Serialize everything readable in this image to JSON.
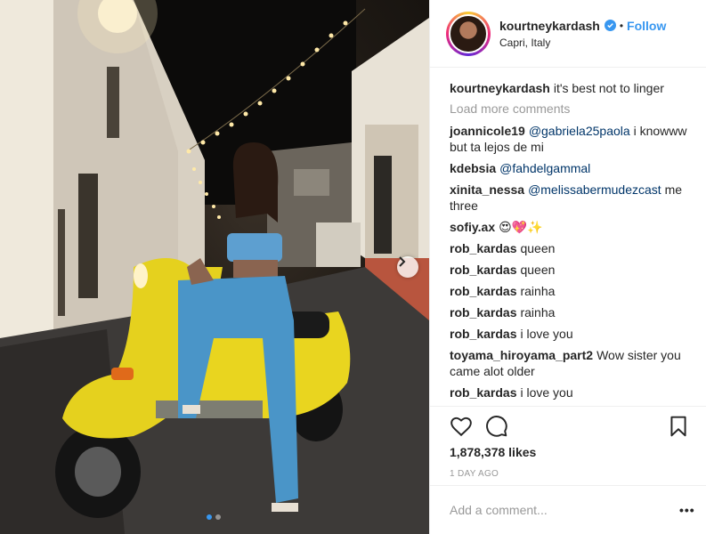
{
  "post": {
    "username": "kourtneykardash",
    "location": "Capri, Italy",
    "separator": "•",
    "follow_label": "Follow",
    "verified_icon": "verified-badge-icon",
    "caption": "it's best not to linger",
    "load_more": "Load more comments",
    "likes": "1,878,378 likes",
    "time": "1 DAY AGO",
    "comment_placeholder": "Add a comment...",
    "more_label": "•••"
  },
  "comments": [
    {
      "user": "joannicole19",
      "mention": "@gabriela25paola",
      "text": "i knowww but ta lejos de mi"
    },
    {
      "user": "kdebsia",
      "mention": "@fahdelgammal",
      "text": ""
    },
    {
      "user": "xinita_nessa",
      "mention": "@melissabermudezcast",
      "text": "me three"
    },
    {
      "user": "sofiy.ax",
      "mention": "",
      "text": "😍💖✨"
    },
    {
      "user": "rob_kardas",
      "mention": "",
      "text": "queen"
    },
    {
      "user": "rob_kardas",
      "mention": "",
      "text": "queen"
    },
    {
      "user": "rob_kardas",
      "mention": "",
      "text": "rainha"
    },
    {
      "user": "rob_kardas",
      "mention": "",
      "text": "rainha"
    },
    {
      "user": "rob_kardas",
      "mention": "",
      "text": "i love you"
    },
    {
      "user": "toyama_hiroyama_part2",
      "mention": "",
      "text": "Wow sister you came alot older"
    },
    {
      "user": "rob_kardas",
      "mention": "",
      "text": "i love you"
    }
  ],
  "carousel": {
    "total": 2,
    "active": 1
  },
  "colors": {
    "accent": "#3897f0",
    "text": "#262626",
    "muted": "#999999",
    "mention": "#003569"
  }
}
